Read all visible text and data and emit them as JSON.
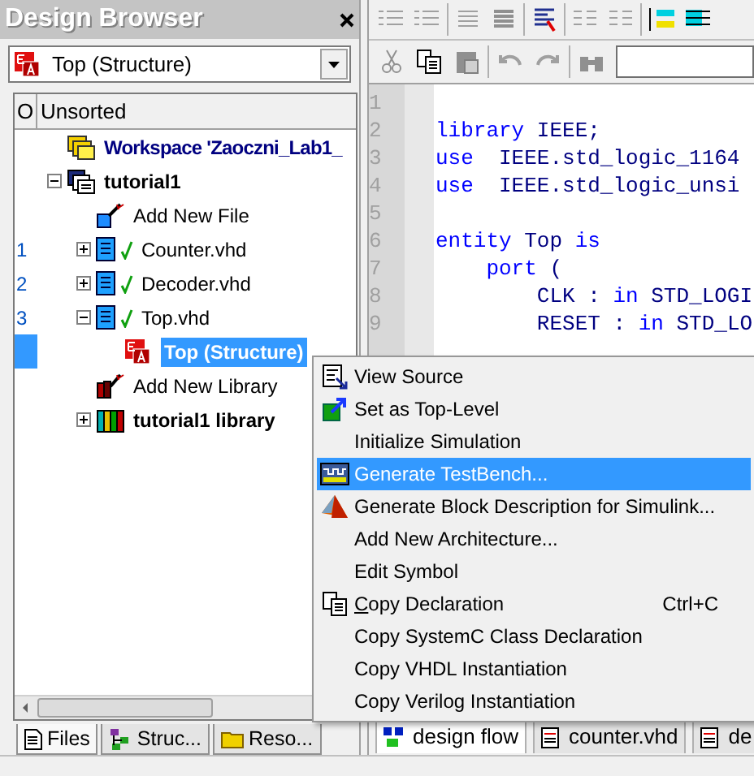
{
  "design_browser": {
    "title": "Design Browser",
    "selector": {
      "value": "Top (Structure)"
    },
    "tree_header": {
      "column_1": "O",
      "column_2": "Unsorted"
    },
    "tree": [
      {
        "label": "Workspace 'Zaoczni_Lab1_",
        "kind": "workspace",
        "selected": false
      },
      {
        "label": "tutorial1",
        "kind": "design",
        "expanded": true,
        "selected": false,
        "children": [
          {
            "label": "Add New File",
            "kind": "wizard",
            "selected": false
          },
          {
            "label": "Counter.vhd",
            "kind": "file",
            "number": "1",
            "expanded": false,
            "checked": true,
            "selected": false
          },
          {
            "label": "Decoder.vhd",
            "kind": "file",
            "number": "2",
            "expanded": false,
            "checked": true,
            "selected": false
          },
          {
            "label": "Top.vhd",
            "kind": "file",
            "number": "3",
            "expanded": true,
            "checked": true,
            "selected": false,
            "children": [
              {
                "label": "Top (Structure)",
                "kind": "entity",
                "selected": true
              }
            ]
          },
          {
            "label": "Add New Library",
            "kind": "library_wizard",
            "selected": false
          },
          {
            "label": "tutorial1 library",
            "kind": "library",
            "expanded": false,
            "selected": false
          }
        ]
      }
    ],
    "tabs": [
      {
        "label": "Files",
        "kind": "files",
        "selected": true
      },
      {
        "label": "Struc...",
        "kind": "structure",
        "selected": false
      },
      {
        "label": "Reso...",
        "kind": "resources",
        "selected": false
      }
    ]
  },
  "editor": {
    "lines": [
      {
        "number": "1"
      },
      {
        "number": "2",
        "segments": [
          {
            "text": "library",
            "kind": "keyword"
          },
          {
            "text": " IEEE;",
            "kind": "plain"
          }
        ]
      },
      {
        "number": "3",
        "segments": [
          {
            "text": "use",
            "kind": "keyword"
          },
          {
            "text": "  IEEE.std_logic_1164",
            "kind": "plain"
          }
        ]
      },
      {
        "number": "4",
        "segments": [
          {
            "text": "use",
            "kind": "keyword"
          },
          {
            "text": "  IEEE.std_logic_unsi",
            "kind": "plain"
          }
        ]
      },
      {
        "number": "5"
      },
      {
        "number": "6",
        "segments": [
          {
            "text": "entity",
            "kind": "keyword"
          },
          {
            "text": " Top ",
            "kind": "plain"
          },
          {
            "text": "is",
            "kind": "keyword"
          }
        ]
      },
      {
        "number": "7",
        "segments": [
          {
            "text": "    port",
            "kind": "keyword"
          },
          {
            "text": " (",
            "kind": "plain"
          }
        ]
      },
      {
        "number": "8",
        "segments": [
          {
            "text": "        CLK : ",
            "kind": "plain"
          },
          {
            "text": "in",
            "kind": "keyword"
          },
          {
            "text": " STD_LOGI",
            "kind": "plain"
          }
        ]
      },
      {
        "number": "9",
        "segments": [
          {
            "text": "        RESET : ",
            "kind": "plain"
          },
          {
            "text": "in",
            "kind": "keyword"
          },
          {
            "text": " STD_LO",
            "kind": "plain"
          }
        ]
      }
    ],
    "tabs": [
      {
        "label": "design flow",
        "kind": "flow",
        "selected": true
      },
      {
        "label": "counter.vhd",
        "kind": "document",
        "selected": false
      },
      {
        "label": "de",
        "kind": "document",
        "selected": false
      }
    ]
  },
  "context_menu": {
    "items": [
      {
        "label": "View Source",
        "kind": "source",
        "selected": false
      },
      {
        "label": "Set as Top-Level",
        "kind": "top",
        "selected": false
      },
      {
        "label": "Initialize Simulation",
        "selected": false
      },
      {
        "label": "Generate TestBench...",
        "kind": "testbench",
        "selected": true
      },
      {
        "label": "Generate Block Description for Simulink...",
        "kind": "simulink",
        "selected": false
      },
      {
        "label": "Add New Architecture...",
        "selected": false
      },
      {
        "label": "Edit Symbol",
        "selected": false
      },
      {
        "mnemonic": "C",
        "label": "opy Declaration",
        "shortcut": "Ctrl+C",
        "kind": "copy",
        "selected": false
      },
      {
        "label": "Copy SystemC Class Declaration",
        "selected": false
      },
      {
        "label": "Copy VHDL Instantiation",
        "selected": false
      },
      {
        "label": "Copy Verilog Instantiation",
        "selected": false
      }
    ]
  }
}
